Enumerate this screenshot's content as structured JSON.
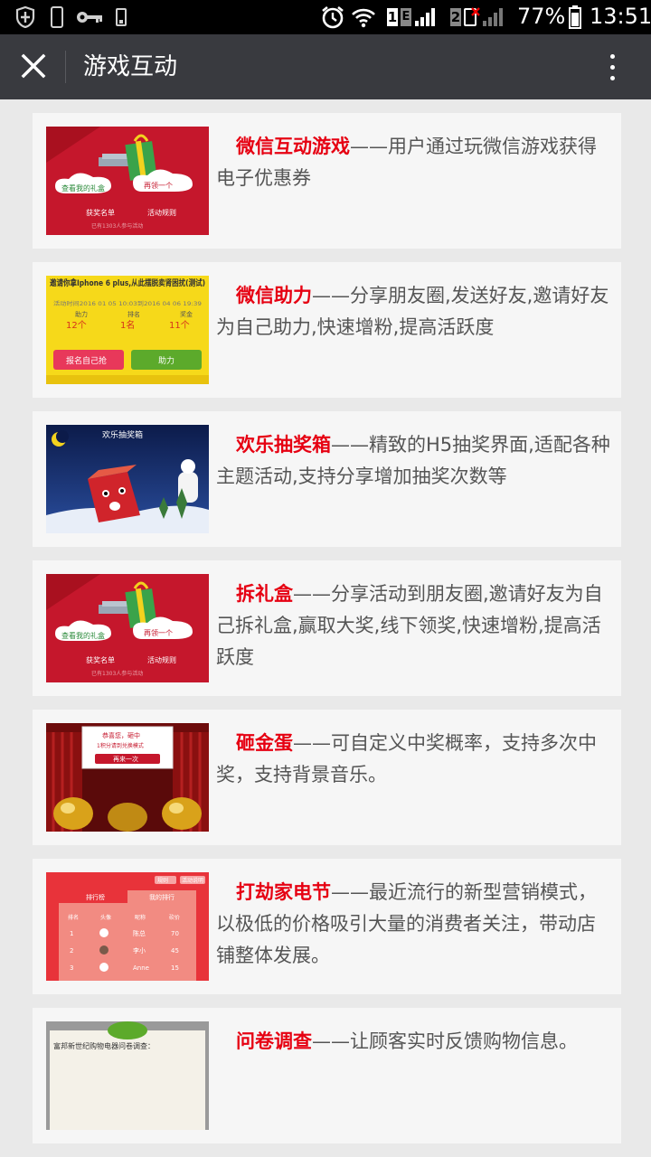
{
  "status_bar": {
    "battery_pct": "77%",
    "time": "13:51",
    "sim1": "1",
    "sim1_type": "E",
    "sim2": "2"
  },
  "navbar": {
    "title": "游戏互动",
    "close_icon": "close-icon",
    "more_icon": "more-vertical-icon"
  },
  "items": [
    {
      "title": "微信互动游戏",
      "sep": "——",
      "desc": "用户通过玩微信游戏获得电子优惠券",
      "thumb": {
        "btn1": "查看我的礼盒",
        "btn2": "再领一个",
        "link1": "获奖名单",
        "link2": "活动规则",
        "footer": "已有1303人参与活动"
      }
    },
    {
      "title": "微信助力",
      "sep": "——",
      "desc": "分享朋友圈,发送好友,邀请好友为自己助力,快速增粉,提高活跃度",
      "thumb": {
        "heading": "邀请你拿Iphone 6 plus,从此摆脱卖肾困扰(测试)",
        "time": "活动时间2016 01 05 10:03到2016 04 06 19:39",
        "labels": [
          "助力",
          "排名",
          "奖金"
        ],
        "values": [
          "12个",
          "1名",
          "11个"
        ],
        "btn1": "报名自己抢",
        "btn2": "助力"
      }
    },
    {
      "title": "欢乐抽奖箱",
      "sep": "——",
      "desc": "精致的H5抽奖界面,适配各种主题活动,支持分享增加抽奖次数等",
      "thumb": {
        "banner": "欢乐抽奖箱"
      }
    },
    {
      "title": "拆礼盒",
      "sep": "——",
      "desc": "分享活动到朋友圈,邀请好友为自己拆礼盒,赢取大奖,线下领奖,快速增粉,提高活跃度",
      "thumb": {
        "btn1": "查看我的礼盒",
        "btn2": "再领一个",
        "link1": "获奖名单",
        "link2": "活动规则",
        "footer": "已有1303人参与活动"
      }
    },
    {
      "title": "砸金蛋",
      "sep": "——",
      "desc": "可自定义中奖概率，支持多次中奖，支持背景音乐。",
      "thumb": {
        "sign1": "恭喜您，砸中",
        "sign2": "1积分请到兑换模式",
        "btn": "再来一次"
      }
    },
    {
      "title": "打劫家电节",
      "sep": "——",
      "desc": "最近流行的新型营销模式，以极低的价格吸引大量的消费者关注，带动店铺整体发展。",
      "thumb": {
        "tab1": "排行榜",
        "tab2": "我的排行",
        "cols": [
          "排名",
          "头像",
          "昵称",
          "砍价"
        ],
        "rows": [
          [
            "1",
            "",
            "陈总",
            "70"
          ],
          [
            "2",
            "",
            "李小",
            "45"
          ],
          [
            "3",
            "",
            "Anne",
            "15"
          ]
        ],
        "corner1": "规则",
        "corner2": "活动说明"
      }
    },
    {
      "title": "问卷调查",
      "sep": "——",
      "desc": "让顾客实时反馈购物信息。",
      "thumb": {
        "line1": "富邦新世纪购物电器问卷调查："
      }
    }
  ]
}
